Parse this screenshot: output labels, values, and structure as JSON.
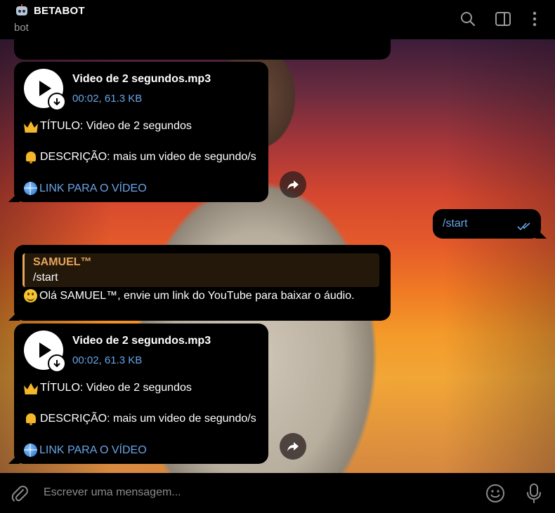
{
  "header": {
    "title": "BETABOT",
    "subtitle": "bot",
    "icons": [
      "search-icon",
      "sidebar-toggle-icon",
      "more-vertical-icon"
    ]
  },
  "messages": {
    "audio1": {
      "file_name": "Video de 2 segundos.mp3",
      "file_meta": "00:02, 61.3 KB",
      "title_line": "TÍTULO: Video de 2 segundos",
      "desc_line": "DESCRIÇÃO: mais um video de segundo/s",
      "link_line": "LINK PARA O VÍDEO"
    },
    "outgoing": {
      "text": "/start"
    },
    "reply": {
      "quote_name": "SAMUEL™",
      "quote_text": "/start",
      "text": "Olá SAMUEL™, envie um link do YouTube para baixar o áudio."
    },
    "audio2": {
      "file_name": "Video de 2 segundos.mp3",
      "file_meta": "00:02, 61.3 KB",
      "title_line": "TÍTULO: Video de 2 segundos",
      "desc_line": "DESCRIÇÃO: mais um video de segundo/s",
      "link_line": "LINK PARA O VÍDEO"
    }
  },
  "composer": {
    "placeholder": "Escrever uma mensagem..."
  },
  "colors": {
    "link": "#6aa5e8",
    "quote_accent": "#e8a55a",
    "bubble_bg": "#000000"
  }
}
